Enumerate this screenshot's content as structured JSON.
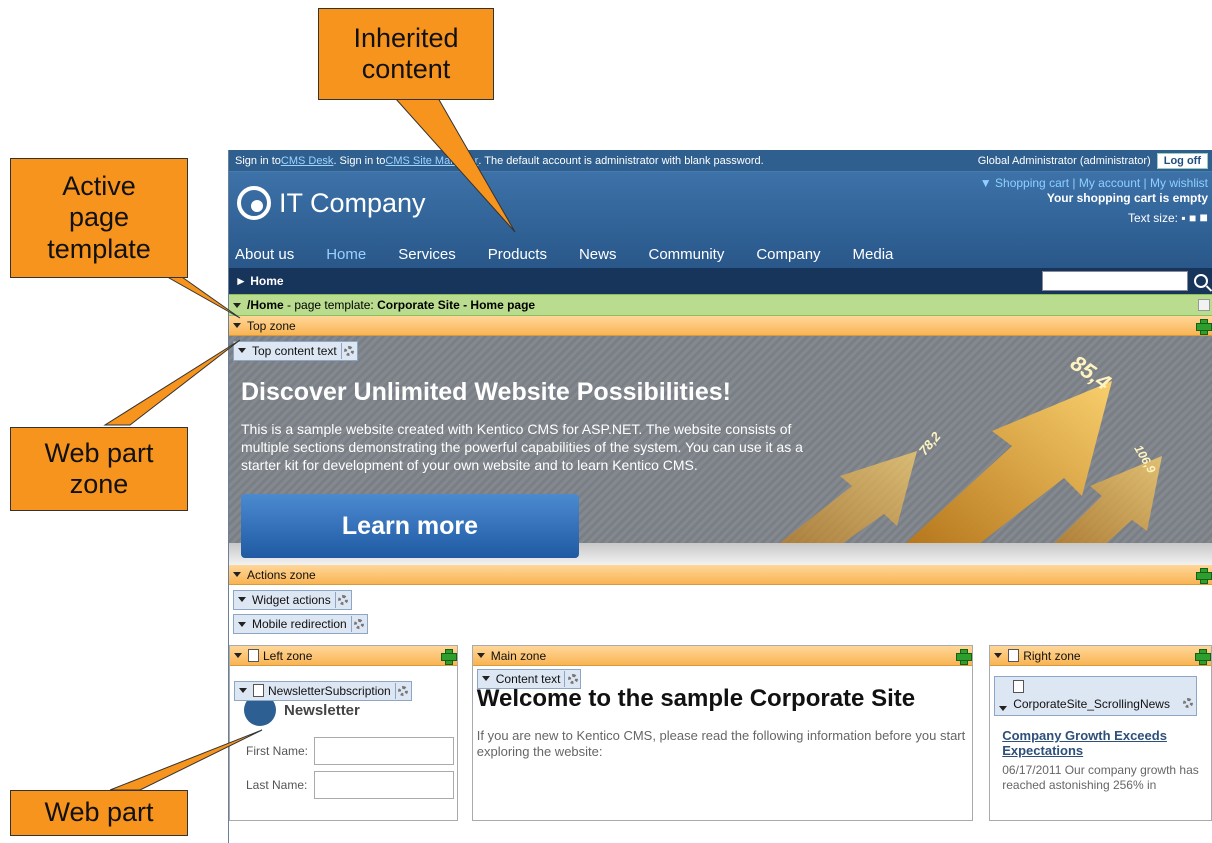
{
  "callouts": {
    "inherited": "Inherited\ncontent",
    "active_template": "Active\npage\ntemplate",
    "web_part_zone": "Web part\nzone",
    "web_part": "Web part"
  },
  "topbar": {
    "sign_in_1": "Sign in to ",
    "cms_desk": "CMS Desk",
    "sign_in_2": ". Sign in to ",
    "site_manager": "CMS Site Manager",
    "default_account": ". The default account is administrator with blank password.",
    "user": "Global Administrator (administrator)",
    "logoff": "Log off"
  },
  "header": {
    "logo_text": "IT Company",
    "cart_links": "Shopping cart | My account | My wishlist",
    "cart_status": "Your shopping cart is empty",
    "text_size": "Text size:"
  },
  "nav": {
    "items": [
      "About us",
      "Home",
      "Services",
      "Products",
      "News",
      "Community",
      "Company",
      "Media"
    ],
    "active_index": 1
  },
  "breadcrumb": {
    "current": "► Home"
  },
  "template_bar": {
    "path": "/Home",
    "label": " - page template: ",
    "template_name": "Corporate Site - Home page"
  },
  "zones": {
    "top": "Top zone",
    "actions": "Actions zone",
    "left": "Left zone",
    "main": "Main zone",
    "right": "Right zone"
  },
  "webparts": {
    "top_content": "Top content text",
    "widget_actions": "Widget actions",
    "mobile_redirection": "Mobile redirection",
    "newsletter": "NewsletterSubscription",
    "content_text": "Content text",
    "scrolling_news": "CorporateSite_ScrollingNews"
  },
  "banner": {
    "title": "Discover Unlimited Website Possibilities!",
    "text": "This is a sample website created with Kentico CMS for ASP.NET. The website consists of multiple sections demonstrating the powerful capabilities of the system. You can use it as a starter kit for development of your own website and to learn Kentico CMS.",
    "button": "Learn more",
    "num1": "85,4",
    "num2": "78,2",
    "num3": "106,9"
  },
  "left": {
    "newsletter_heading": "Newsletter",
    "first_name": "First Name:",
    "last_name": "Last Name:"
  },
  "main": {
    "title": "Welcome to the sample Corporate Site",
    "intro": "If you are new to Kentico CMS, please read the following information before you start exploring the website:"
  },
  "right": {
    "news_title": "Company Growth Exceeds Expectations",
    "news_text": "06/17/2011 Our company growth has reached astonishing 256% in"
  },
  "colors": {
    "callout": "#f7941e",
    "zone": "#f9b453",
    "template": "#b9dc8e",
    "header": "#2e5f93"
  }
}
